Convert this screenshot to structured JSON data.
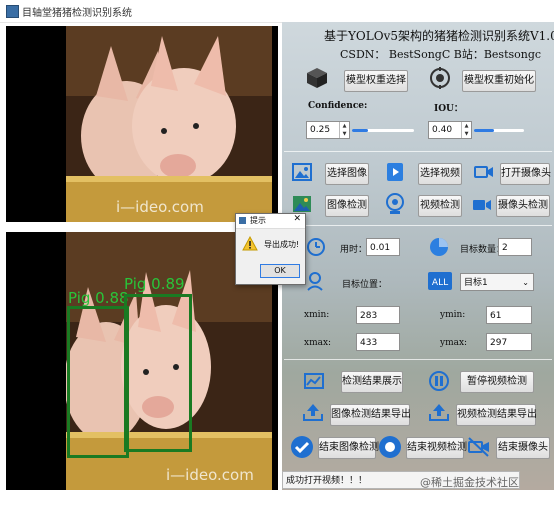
{
  "window": {
    "title": "目轴堂猪猪检测识别系统"
  },
  "panel": {
    "title": "基于YOLOv5架构的猪猪检测识别系统V1.0",
    "credit_line": "CSDN：  BestSongC   B站：Bestsongc",
    "model_select_button": "模型权重选择",
    "model_init_button": "模型权重初始化",
    "confidence_label": "Confidence:",
    "iou_label": "IOU：",
    "confidence_value": "0.25",
    "confidence_level": 0.25,
    "iou_value": "0.40",
    "iou_level": 0.4,
    "select_image_button": "选择图像",
    "select_video_button": "选择视频",
    "open_camera_button": "打开摄像头",
    "image_detect_button": "图像检测",
    "video_detect_button": "视频检测",
    "camera_detect_button": "摄像头检测",
    "time_label": "用时：",
    "time_value": "0.01",
    "target_count_label": "目标数量：",
    "target_count_value": "2",
    "target_position_label": "目标位置：",
    "target_select_value": "目标1",
    "xmin_label": "xmin:",
    "xmin_value": "283",
    "ymin_label": "ymin:",
    "ymin_value": "61",
    "xmax_label": "xmax:",
    "xmax_value": "433",
    "ymax_label": "ymax:",
    "ymax_value": "297",
    "show_results_button": "检测结果展示",
    "pause_video_button": "暂停视频检测",
    "export_image_button": "图像检测结果导出",
    "export_video_button": "视频检测结果导出",
    "end_image_button": "结束图像检测",
    "end_video_button": "结束视频检测",
    "end_camera_button": "结束摄像头"
  },
  "status": {
    "text": "成功打开视频！！！"
  },
  "detections": [
    {
      "label": "Pig 0.88"
    },
    {
      "label": "Pig 0.89"
    }
  ],
  "watermark": {
    "top": "i—ideo.com",
    "bottom": "i—ideo.com"
  },
  "dialog": {
    "title": "提示",
    "message": "导出成功!",
    "ok_label": "OK"
  },
  "footer": {
    "credit": "@稀土掘金技术社区"
  },
  "colors": {
    "box": "#1a7a22",
    "accent": "#2f7be3"
  }
}
